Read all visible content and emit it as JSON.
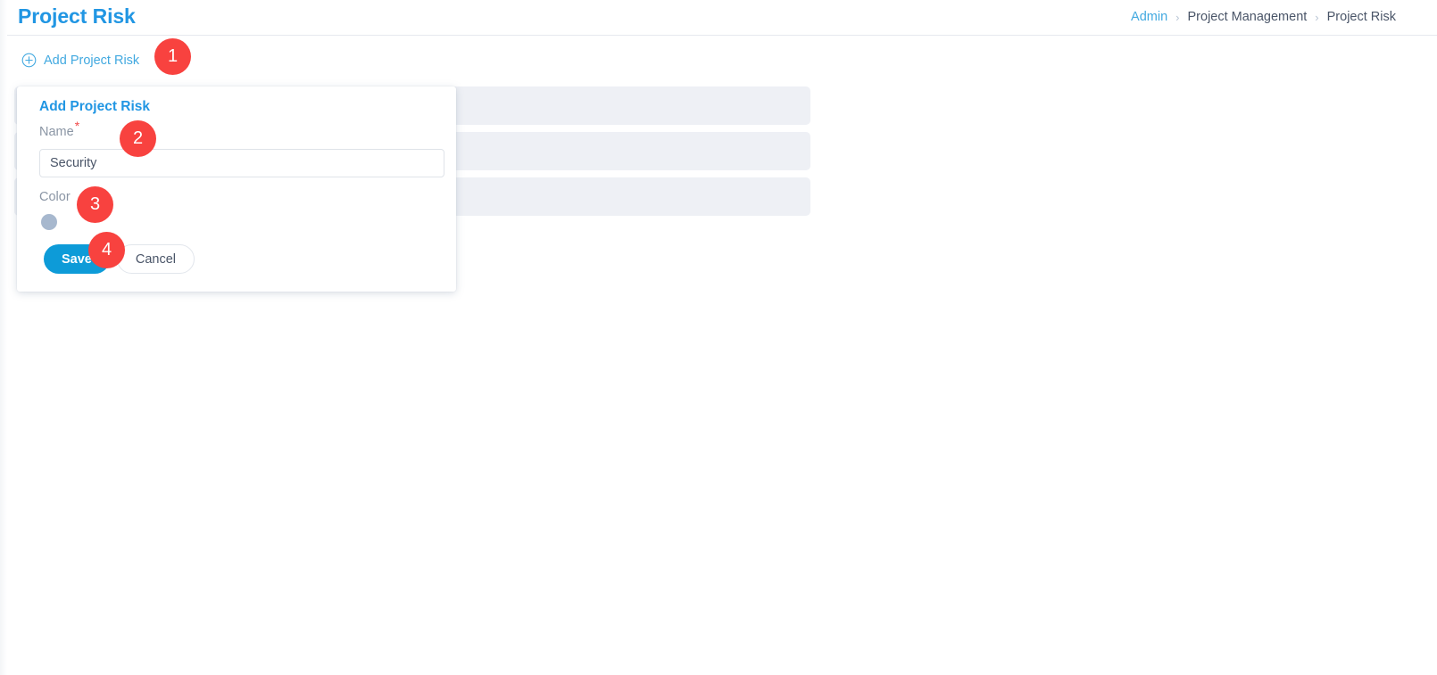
{
  "header": {
    "title": "Project Risk",
    "breadcrumb": [
      {
        "label": "Admin",
        "type": "link"
      },
      {
        "label": "Project Management",
        "type": "text"
      },
      {
        "label": "Project Risk",
        "type": "text"
      }
    ],
    "separator": "›"
  },
  "toolbar": {
    "add_label": "Add Project Risk",
    "add_icon": "plus-circle-icon"
  },
  "list": {
    "placeholder_rows": 3
  },
  "card": {
    "title": "Add Project Risk",
    "name_label": "Name",
    "required_marker": "*",
    "name_value": "Security",
    "name_placeholder": "",
    "color_label": "Color",
    "color_value": "#a7b8ce",
    "save_label": "Save",
    "cancel_label": "Cancel"
  },
  "annotations": [
    {
      "number": "1",
      "target": "add-project-risk-link"
    },
    {
      "number": "2",
      "target": "name-input"
    },
    {
      "number": "3",
      "target": "color-swatch"
    },
    {
      "number": "4",
      "target": "save-button"
    }
  ],
  "colors": {
    "accent_blue": "#2196e3",
    "link_blue": "#42a9e0",
    "save_blue": "#0d9bd8",
    "badge_red": "#f8423f",
    "required_red": "#f04b4b",
    "skeleton_gray": "#eef0f5",
    "label_gray": "#8b96a5"
  }
}
